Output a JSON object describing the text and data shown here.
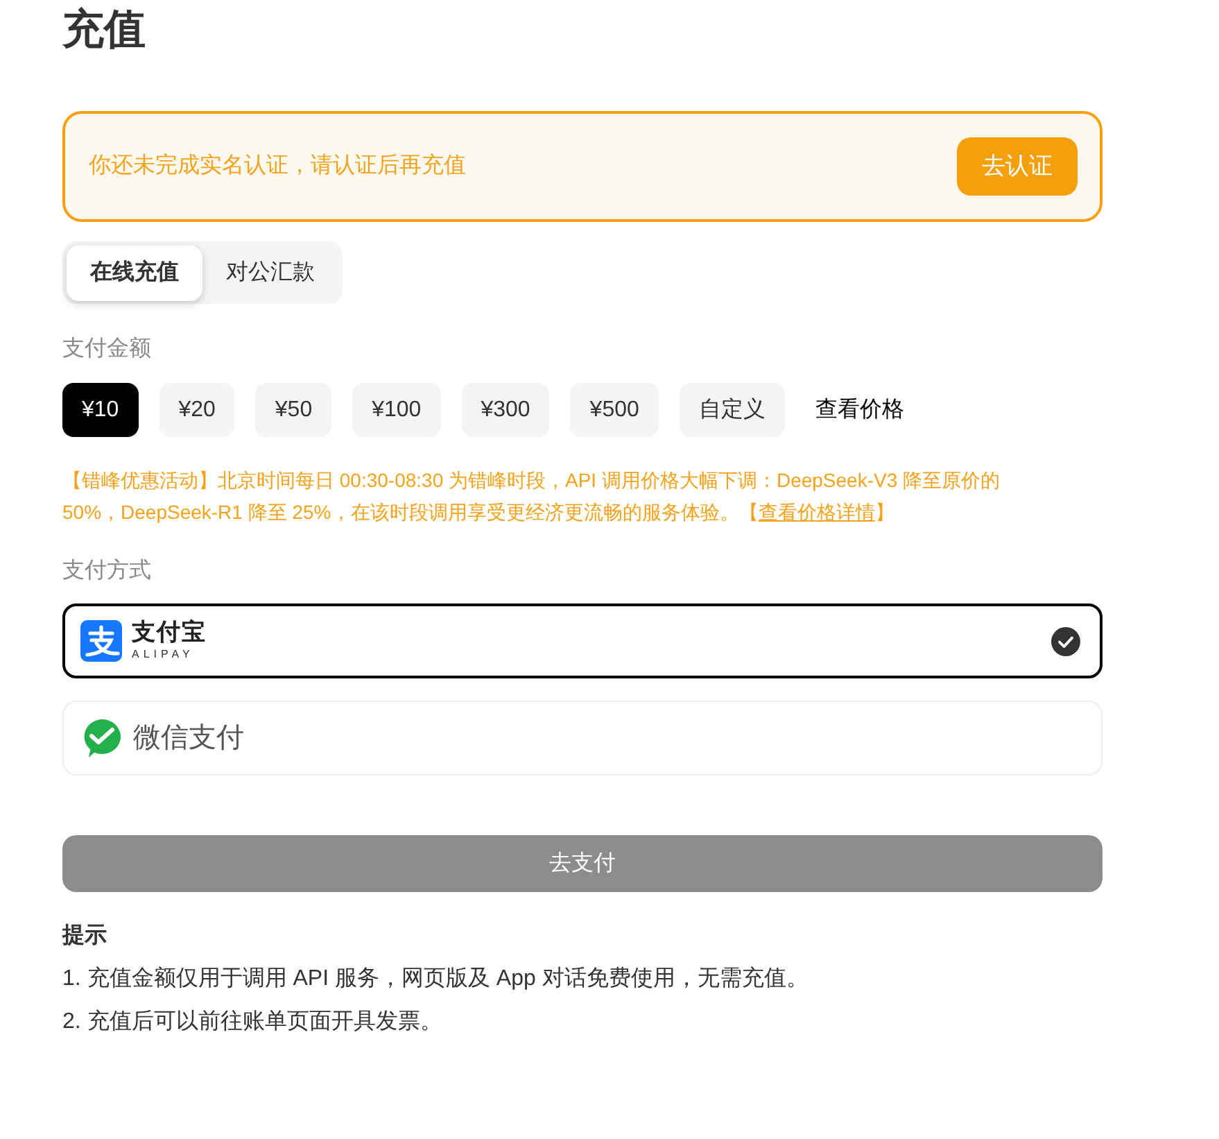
{
  "page": {
    "title": "充值"
  },
  "verify_alert": {
    "message": "你还未完成实名认证，请认证后再充值",
    "button": "去认证"
  },
  "tabs": [
    {
      "label": "在线充值",
      "selected": true
    },
    {
      "label": "对公汇款",
      "selected": false
    }
  ],
  "amount": {
    "label": "支付金额",
    "options": [
      {
        "label": "¥10",
        "selected": true
      },
      {
        "label": "¥20",
        "selected": false
      },
      {
        "label": "¥50",
        "selected": false
      },
      {
        "label": "¥100",
        "selected": false
      },
      {
        "label": "¥300",
        "selected": false
      },
      {
        "label": "¥500",
        "selected": false
      },
      {
        "label": "自定义",
        "selected": false
      }
    ],
    "price_link": "查看价格"
  },
  "promo": {
    "text": "【错峰优惠活动】北京时间每日 00:30-08:30 为错峰时段，API 调用价格大幅下调：DeepSeek-V3 降至原价的 50%，DeepSeek-R1 降至 25%，在该时段调用享受更经济更流畅的服务体验。【",
    "link": "查看价格详情",
    "tail": "】"
  },
  "payment": {
    "label": "支付方式",
    "methods": [
      {
        "kind": "alipay",
        "name": "支付宝",
        "subtitle": "ALIPAY",
        "selected": true
      },
      {
        "kind": "wechat",
        "name": "微信支付",
        "selected": false
      }
    ]
  },
  "pay_button": {
    "label": "去支付",
    "disabled": true
  },
  "tips": {
    "title": "提示",
    "items": [
      "1. 充值金额仅用于调用 API 服务，网页版及 App 对话免费使用，无需充值。",
      "2. 充值后可以前往账单页面开具发票。"
    ]
  }
}
